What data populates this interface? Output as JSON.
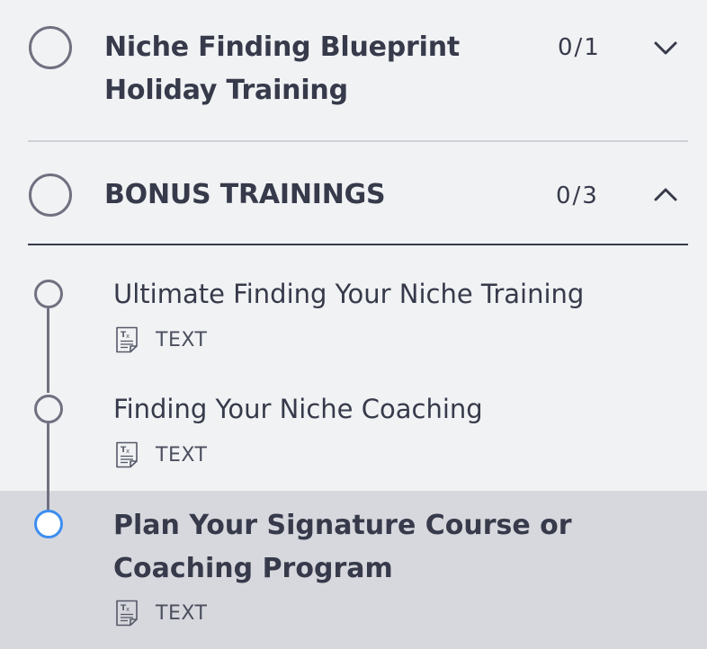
{
  "sections": [
    {
      "title_line1": "Niche Finding Blueprint",
      "title_line2": "Holiday Training",
      "count": "0/1",
      "expanded": false
    },
    {
      "title_line1": "BONUS TRAININGS",
      "count": "0/3",
      "expanded": true
    }
  ],
  "lessons": [
    {
      "title": "Ultimate Finding Your Niche Training",
      "type": "TEXT",
      "active": false
    },
    {
      "title": "Finding Your Niche Coaching",
      "type": "TEXT",
      "active": false
    },
    {
      "title": "Plan Your Signature Course or Coaching Program",
      "type": "TEXT",
      "active": true
    }
  ],
  "colors": {
    "background": "#f1f2f4",
    "active_background": "#d7d8dd",
    "text": "#363a4a",
    "muted_circle": "#6f7180",
    "active_circle": "#3d8ef0"
  },
  "icons": {
    "collapsed": "chevron-down-icon",
    "expanded": "chevron-up-icon",
    "lesson_type": "text-document-icon"
  }
}
